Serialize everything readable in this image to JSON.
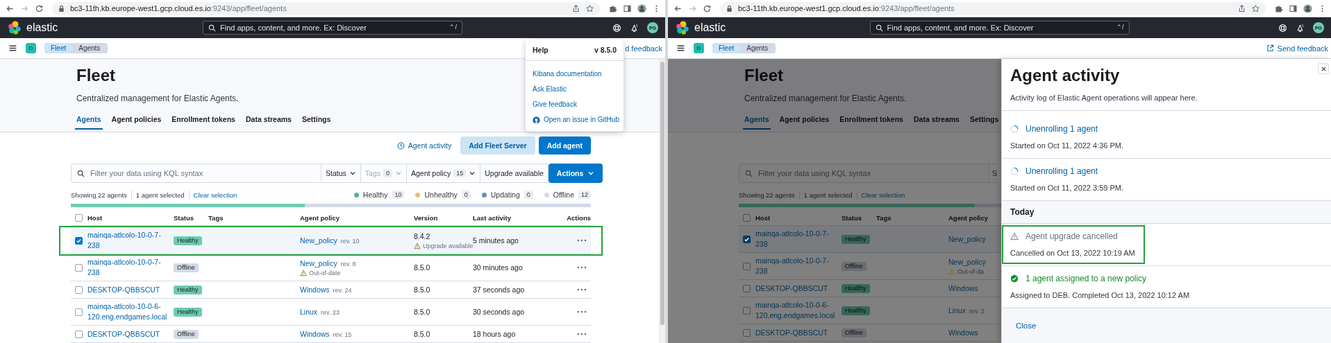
{
  "windows": [
    {
      "browser": {
        "url_host": "bc3-11th.kb.europe-west1.gcp.cloud.es.io",
        "url_path": ":9243/app/fleet/agents"
      },
      "header": {
        "logo": "elastic",
        "search_placeholder": "Find apps, content, and more. Ex: Discover",
        "shortcut": "⌃/",
        "avatar": "PG"
      },
      "breadcrumb_bar": {
        "space": "D",
        "breadcrumbs": [
          {
            "label": "Fleet",
            "current": false
          },
          {
            "label": "Agents",
            "current": true
          }
        ],
        "feedback": {
          "label": "d feedback",
          "icon": false
        }
      },
      "help_menu": {
        "title": "Help",
        "version": "v 8.5.0",
        "links": [
          {
            "label": "Kibana documentation",
            "kind": "link"
          },
          {
            "label": "Ask Elastic",
            "kind": "link"
          },
          {
            "label": "Give feedback",
            "kind": "link"
          },
          {
            "label": "Open an issue in GitHub",
            "kind": "github"
          }
        ]
      },
      "page": {
        "dimmed": false,
        "title": "Fleet",
        "subtitle": "Centralized management for Elastic Agents.",
        "tabs": [
          {
            "label": "Agents",
            "selected": true
          },
          {
            "label": "Agent policies",
            "selected": false
          },
          {
            "label": "Enrollment tokens",
            "selected": false
          },
          {
            "label": "Data streams",
            "selected": false
          },
          {
            "label": "Settings",
            "selected": false
          }
        ],
        "buttons": [
          {
            "label": "Agent activity",
            "kind": "link"
          },
          {
            "label": "Add Fleet Server",
            "kind": "secondary"
          },
          {
            "label": "Add agent",
            "kind": "primary"
          }
        ],
        "filters": {
          "placeholder": "Filter your data using KQL syntax",
          "controls": [
            {
              "label": "Status",
              "kind": "dropdown",
              "disabled": false
            },
            {
              "label": "Tags",
              "count": "0",
              "kind": "dropdown",
              "disabled": true
            },
            {
              "label": "Agent policy",
              "count": "15",
              "kind": "dropdown",
              "disabled": false
            },
            {
              "label": "Upgrade available",
              "kind": "toggle",
              "disabled": false
            }
          ],
          "action": "Actions"
        },
        "summary": {
          "showing": "Showing 22 agents",
          "selected": "1 agent selected",
          "clear": "Clear selection",
          "statuses": [
            {
              "label": "Healthy",
              "count": "10",
              "color": "#54b399"
            },
            {
              "label": "Unhealthy",
              "count": "0",
              "color": "#e7c36b"
            },
            {
              "label": "Updating",
              "count": "0",
              "color": "#6092c0"
            },
            {
              "label": "Offline",
              "count": "12",
              "color": "#d3dae6"
            }
          ]
        },
        "health_bar": {
          "level": 0.45
        },
        "table": {
          "columns": [
            "Host",
            "Status",
            "Tags",
            "Agent policy",
            "Version",
            "Last activity",
            "Actions"
          ],
          "rows": [
            {
              "checked": true,
              "highlighted": true,
              "host": "mainqa-atlcolo-10-0-7-238",
              "status": "Healthy",
              "color": "#6dccb1",
              "policy": "New_policy",
              "revision": "rev. 10",
              "version": "8.4.2",
              "version_warning": "Upgrade available",
              "last_activity": "5 minutes ago"
            },
            {
              "checked": false,
              "highlighted": false,
              "host": "mainqa-atlcolo-10-0-7-238",
              "status": "Offline",
              "color": "#d3dae6",
              "policy": "New_policy",
              "revision": "rev. 8",
              "policy_warning": "Out-of-date",
              "version": "8.5.0",
              "last_activity": "30 minutes ago"
            },
            {
              "checked": false,
              "highlighted": false,
              "host": "DESKTOP-QBBSCUT",
              "status": "Healthy",
              "color": "#6dccb1",
              "policy": "Windows",
              "revision": "rev. 24",
              "version": "8.5.0",
              "last_activity": "37 seconds ago"
            },
            {
              "checked": false,
              "highlighted": false,
              "host": "mainqa-atlcolo-10-0-6-120.eng.endgames.local",
              "status": "Healthy",
              "color": "#6dccb1",
              "policy": "Linux",
              "revision": "rev. 23",
              "version": "8.5.0",
              "last_activity": "30 seconds ago"
            },
            {
              "checked": false,
              "highlighted": false,
              "host": "DESKTOP-QBBSCUT",
              "status": "Offline",
              "color": "#d3dae6",
              "policy": "Windows",
              "revision": "rev. 15",
              "version": "8.5.0",
              "last_activity": "18 hours ago"
            }
          ]
        }
      }
    },
    {
      "browser": {
        "url_host": "bc3-11th.kb.europe-west1.gcp.cloud.es.io",
        "url_path": ":9243/app/fleet/agents"
      },
      "header": {
        "logo": "elastic",
        "search_placeholder": "Find apps, content, and more. Ex: Discover",
        "shortcut": "⌃/",
        "avatar": "PG"
      },
      "breadcrumb_bar": {
        "space": "D",
        "breadcrumbs": [
          {
            "label": "Fleet",
            "current": false
          },
          {
            "label": "Agents",
            "current": true
          }
        ],
        "feedback": {
          "label": "Send feedback",
          "icon": true
        }
      },
      "page": {
        "dimmed": true,
        "title": "Fleet",
        "subtitle": "Centralized management for Elastic Agents.",
        "tabs": [
          {
            "label": "Agents",
            "selected": true
          },
          {
            "label": "Agent policies",
            "selected": false
          },
          {
            "label": "Enrollment tokens",
            "selected": false
          },
          {
            "label": "Data streams",
            "selected": false
          },
          {
            "label": "Settings",
            "selected": false
          }
        ],
        "filters": {
          "placeholder": "Filter your data using KQL syntax",
          "controls": [
            {
              "label": "S",
              "kind": "fragment",
              "disabled": false
            }
          ]
        },
        "summary": {
          "showing": "Showing 22 agents",
          "selected": "1 agent selected",
          "clear": "Clear selection"
        },
        "health_bar": {
          "level": 0.9
        },
        "table": {
          "columns": [
            "Host",
            "Status",
            "Tags",
            "Agent policy"
          ],
          "rows": [
            {
              "checked": true,
              "highlighted": false,
              "host": "mainqa-atlcolo-10-0-7-238",
              "status": "Healthy",
              "color": "#37665a",
              "policy": "New_policy"
            },
            {
              "checked": false,
              "highlighted": false,
              "host": "mainqa-atlcolo-10-0-7-238",
              "status": "Offline",
              "color": "#6a6d73",
              "policy": "New_policy",
              "policy_warning": "Out-of-da"
            },
            {
              "checked": false,
              "highlighted": false,
              "host": "DESKTOP-QBBSCUT",
              "status": "Healthy",
              "color": "#37665a",
              "policy": "Windows"
            },
            {
              "checked": false,
              "highlighted": false,
              "host": "mainqa-atlcolo-10-0-6-120.eng.endgames.local",
              "status": "Healthy",
              "color": "#37665a",
              "policy": "Linux",
              "revision": "rev. 2"
            },
            {
              "checked": false,
              "highlighted": false,
              "host": "DESKTOP-QBBSCUT",
              "status": "Offline",
              "color": "#6a6d73",
              "policy": "Windows"
            }
          ]
        }
      },
      "flyout": {
        "title": "Agent activity",
        "description": "Activity log of Elastic Agent operations will appear here.",
        "items": [
          {
            "kind": "in_progress",
            "title": "Unenrolling 1 agent",
            "detail": "Started on Oct 11, 2022 4:36 PM.",
            "highlighted": false
          },
          {
            "kind": "in_progress",
            "title": "Unenrolling 1 agent",
            "detail": "Started on Oct 11, 2022 3:59 PM.",
            "highlighted": false
          },
          {
            "kind": "heading",
            "title": "Today"
          },
          {
            "kind": "warning",
            "title": "Agent upgrade cancelled",
            "detail": "Cancelled on Oct 13, 2022 10:19 AM",
            "highlighted": true
          },
          {
            "kind": "complete",
            "title": "1 agent assigned to a new policy",
            "detail": "Assigned to DEB. Completed Oct 13, 2022 10:12 AM",
            "highlighted": false
          }
        ],
        "close": "Close"
      }
    }
  ]
}
